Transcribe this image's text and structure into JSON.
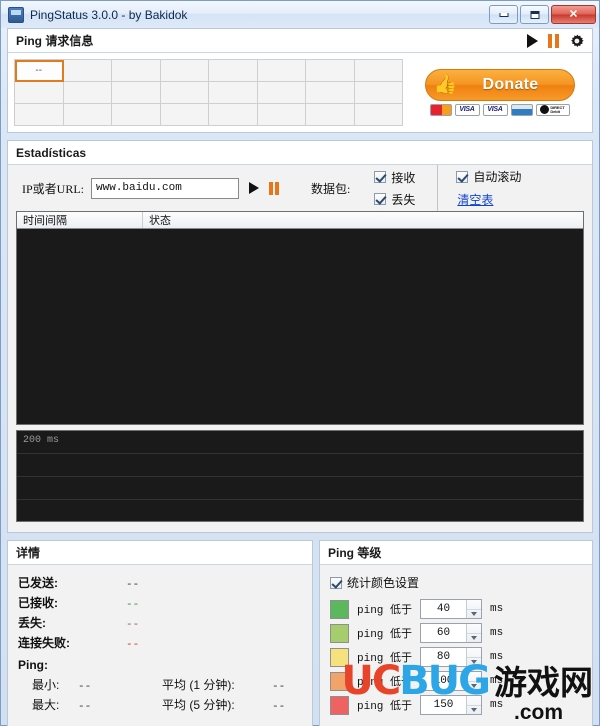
{
  "window": {
    "title": "PingStatus 3.0.0 - by Bakidok",
    "app_icon": "app-icon",
    "minimize_label": "_",
    "maximize_label": "□",
    "close_label": "✕"
  },
  "request_panel": {
    "title": "Ping 请求信息",
    "play_icon": "play-icon",
    "pause_icon": "pause-icon",
    "settings_icon": "gear-icon",
    "grid": {
      "columns": 8,
      "rows": 3,
      "selected_cell_value": "--",
      "cells": [
        "--",
        "",
        "",
        "",
        "",
        "",
        "",
        "",
        "",
        "",
        "",
        "",
        "",
        "",
        "",
        "",
        "",
        "",
        "",
        "",
        "",
        "",
        "",
        ""
      ]
    }
  },
  "donate": {
    "label": "Donate",
    "thumb_icon": "thumbs-up-icon",
    "cards": [
      {
        "name": "mastercard-icon",
        "text": ""
      },
      {
        "name": "visa-icon",
        "text": "VISA"
      },
      {
        "name": "visa-electron-icon",
        "text": "VISA"
      },
      {
        "name": "bank-card-icon",
        "text": ""
      },
      {
        "name": "direct-debit-icon",
        "line1": "DIRECT",
        "line2": "Debit"
      }
    ]
  },
  "stats": {
    "title": "Estadísticas",
    "ip_label": "IP或者URL:",
    "ip_value": "www.baidu.com",
    "ip_placeholder": "www.baidu.com",
    "play_icon": "play-icon",
    "pause_icon": "pause-icon",
    "packets_label": "数据包:",
    "checkbox_received": "接收",
    "checkbox_lost": "丢失",
    "checkbox_autoscroll": "自动滚动",
    "clear_table_link": "清空表",
    "table": {
      "columns": [
        "时间间隔",
        "状态"
      ],
      "rows": []
    },
    "graph": {
      "scale_label": "200 ms",
      "gridlines": 4
    }
  },
  "details": {
    "title": "详情",
    "rows": [
      {
        "key": "已发送:",
        "value": "--",
        "color": "#333333"
      },
      {
        "key": "已接收:",
        "value": "--",
        "color": "#2e8b2e"
      },
      {
        "key": "丢失:",
        "value": "--",
        "color": "#8a5a4a"
      },
      {
        "key": "连接失败:",
        "value": "--",
        "color": "#cc3322"
      }
    ],
    "ping_label": "Ping:",
    "ping_rows": [
      {
        "k1": "最小:",
        "v1": "--",
        "k2": "平均 (1 分钟):",
        "v2": "--"
      },
      {
        "k1": "最大:",
        "v1": "--",
        "k2": "平均 (5 分钟):",
        "v2": "--"
      }
    ]
  },
  "levels": {
    "title": "Ping 等级",
    "enable_label": "统计颜色设置",
    "unit": "ms",
    "rows": [
      {
        "color": "#5cb85c",
        "text": "ping 低于",
        "value": "40"
      },
      {
        "color": "#a5cd6b",
        "text": "ping 低于",
        "value": "60"
      },
      {
        "color": "#f5e27e",
        "text": "ping 低于",
        "value": "80"
      },
      {
        "color": "#f0a469",
        "text": "ping 低于",
        "value": "100"
      },
      {
        "color": "#ef6262",
        "text": "ping 低于",
        "value": "150"
      }
    ]
  },
  "watermark": {
    "uc": "UC",
    "bug": "BUG",
    "cn": "游戏网",
    "com": ".com"
  }
}
